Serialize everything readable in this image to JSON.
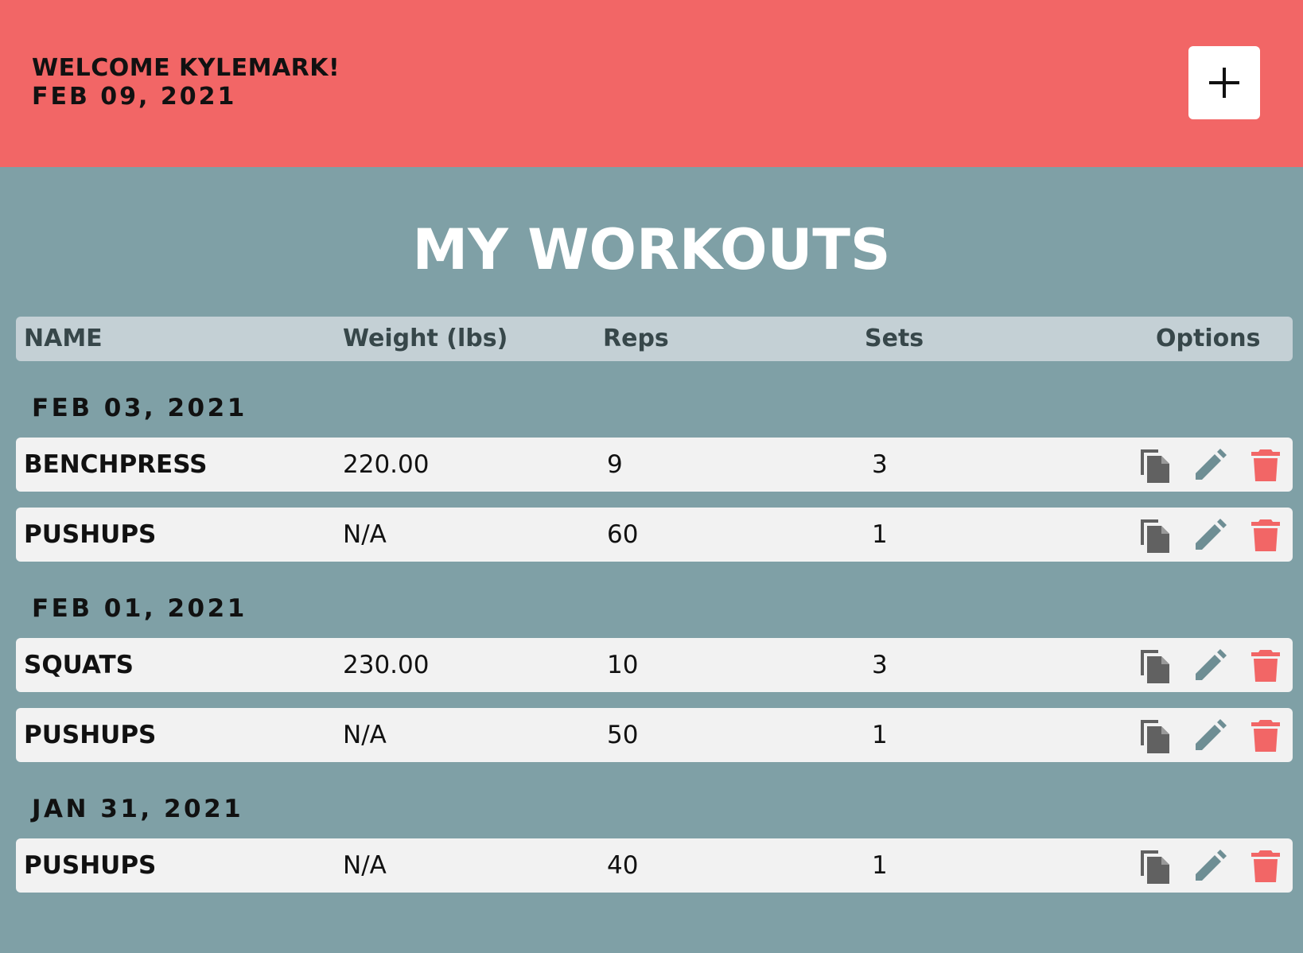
{
  "header": {
    "welcome": "WELCOME KYLEMARK!",
    "date": "FEB 09, 2021",
    "add_button_icon": "plus-icon"
  },
  "page_title": "MY WORKOUTS",
  "table": {
    "columns": [
      "NAME",
      "Weight (lbs)",
      "Reps",
      "Sets",
      "Options"
    ],
    "groups": [
      {
        "date": "FEB 03, 2021",
        "rows": [
          {
            "name": "BENCHPRESS",
            "weight": "220.00",
            "reps": "9",
            "sets": "3"
          },
          {
            "name": "PUSHUPS",
            "weight": "N/A",
            "reps": "60",
            "sets": "1"
          }
        ]
      },
      {
        "date": "FEB 01, 2021",
        "rows": [
          {
            "name": "SQUATS",
            "weight": "230.00",
            "reps": "10",
            "sets": "3"
          },
          {
            "name": "PUSHUPS",
            "weight": "N/A",
            "reps": "50",
            "sets": "1"
          }
        ]
      },
      {
        "date": "JAN 31, 2021",
        "rows": [
          {
            "name": "PUSHUPS",
            "weight": "N/A",
            "reps": "40",
            "sets": "1"
          }
        ]
      }
    ]
  },
  "option_icons": [
    "copy-icon",
    "pencil-icon",
    "trash-icon"
  ],
  "colors": {
    "topbar": "#f26666",
    "background": "#7fa0a6",
    "header_row": "#c4d0d5",
    "row": "#f2f2f2",
    "copy_icon": "#616161",
    "edit_icon": "#6e8e94",
    "delete_icon": "#f26666"
  }
}
